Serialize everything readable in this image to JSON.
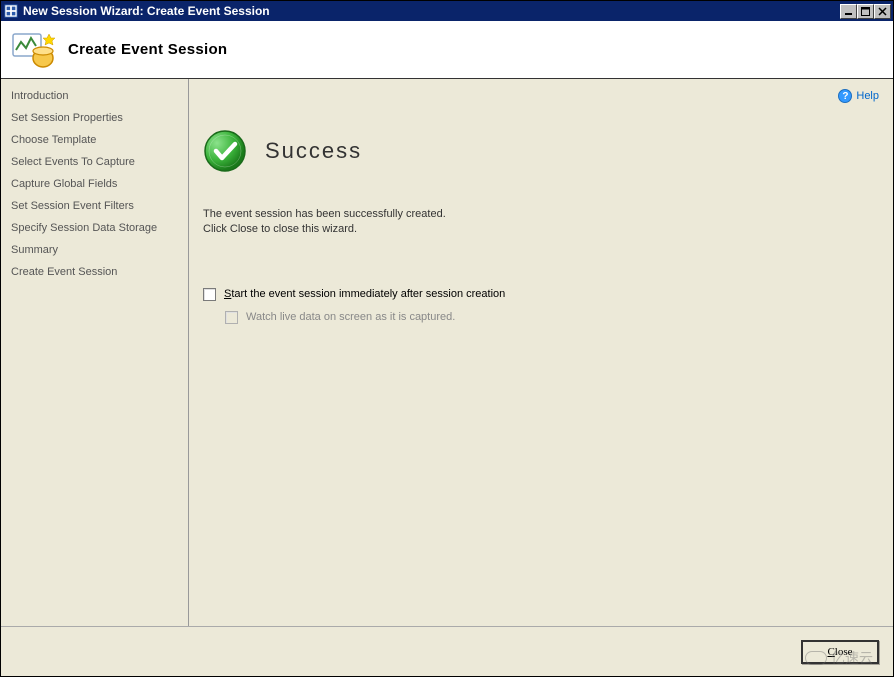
{
  "window": {
    "title": "New Session Wizard: Create Event Session",
    "controls": {
      "minimize": "_",
      "maximize": "□",
      "close": "✕"
    }
  },
  "header": {
    "title": "Create Event Session"
  },
  "sidebar": {
    "items": [
      {
        "label": "Introduction"
      },
      {
        "label": "Set Session Properties"
      },
      {
        "label": "Choose Template"
      },
      {
        "label": "Select Events To Capture"
      },
      {
        "label": "Capture Global Fields"
      },
      {
        "label": "Set Session Event Filters"
      },
      {
        "label": "Specify Session Data Storage"
      },
      {
        "label": "Summary"
      },
      {
        "label": "Create Event Session"
      }
    ]
  },
  "main": {
    "help_label": "Help",
    "success_heading": "Success",
    "success_message_line1": "The event session has been successfully created.",
    "success_message_line2": "Click Close to close this wizard.",
    "checkbox_start": {
      "label_prefix": "S",
      "label_rest": "tart the event session immediately after session creation"
    },
    "checkbox_watch": {
      "label": "Watch live data on screen as it is captured."
    }
  },
  "footer": {
    "close_label": "Close"
  },
  "watermark": "亿速云"
}
